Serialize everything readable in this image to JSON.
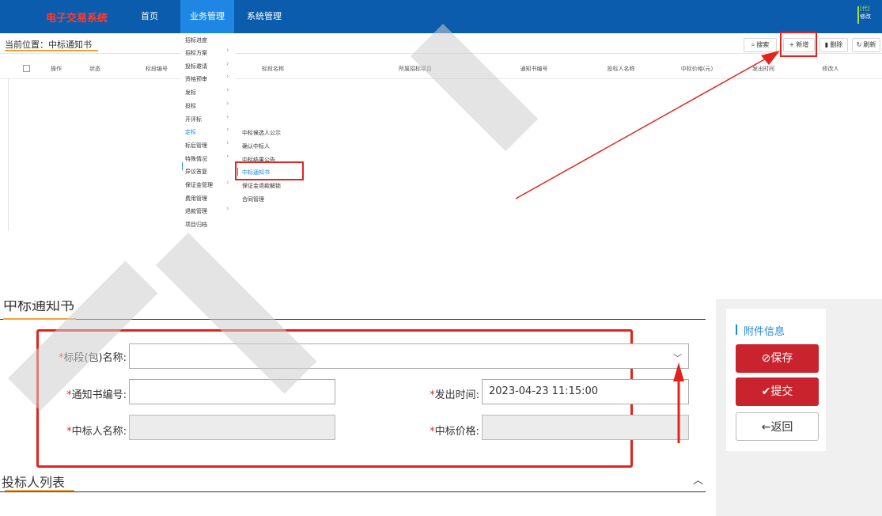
{
  "top_screenshot": {
    "brand": "电子交易系统",
    "nav": [
      "首页",
      "业务管理",
      "系统管理"
    ],
    "user": {
      "tag": "[代]",
      "line2": "修改"
    },
    "breadcrumb": "当前位置：中标通知书",
    "toolbar": {
      "search": "搜索",
      "add": "新增",
      "delete": "删除",
      "refresh": "刷新"
    },
    "table_headers": [
      "操作",
      "状态",
      "标段编号",
      "标段名称",
      "所属招标项目",
      "通知书编号",
      "投标人名称",
      "中标价格(元)",
      "发出时间",
      "修改人"
    ],
    "menu_level1": [
      "招标进度",
      "招标方案",
      "投标邀请",
      "资格预审",
      "发标",
      "投标",
      "开评标",
      "定标",
      "标后管理",
      "特殊情况",
      "异议答复",
      "保证金管理",
      "费用管理",
      "退款管理",
      "项目归档"
    ],
    "menu_level2": [
      "中标候选人公示",
      "确认中标人",
      "中标结果公告",
      "中标通知书",
      "保证金退款解锁",
      "合同管理"
    ],
    "active_level1": "定标",
    "active_level2": "中标通知书"
  },
  "bottom_screenshot": {
    "section_title": "中标通知书",
    "form": {
      "section_label": "标段(包)名称:",
      "notice_no_label": "通知书编号:",
      "notice_no_value": "",
      "issue_time_label": "发出时间:",
      "issue_time_value": "2023-04-23 11:15:00",
      "winner_name_label": "中标人名称:",
      "winner_name_value": "",
      "winning_price_label": "中标价格:",
      "winning_price_value": "",
      "required_mark": "*"
    },
    "list_title": "投标人列表",
    "side": {
      "attach_title": "附件信息",
      "save": "保存",
      "submit": "提交",
      "back": "返回"
    }
  },
  "colors": {
    "topbar": "#0b5cad",
    "nav_active": "#1e87e6",
    "highlight": "#e3241b",
    "accent_underline": "#f2a23a",
    "primary_button": "#c9232d"
  },
  "icons": [
    "search-icon",
    "plus-icon",
    "trash-icon",
    "refresh-icon",
    "chevron-right-icon",
    "chevron-down-icon",
    "caret-up-icon",
    "check-circle-icon",
    "checkmark-icon",
    "arrow-left-icon"
  ]
}
